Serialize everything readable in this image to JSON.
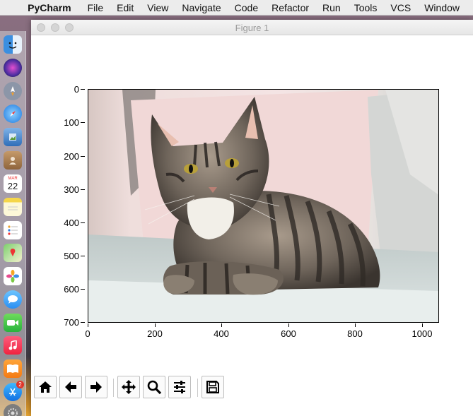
{
  "menubar": {
    "app": "PyCharm",
    "items": [
      "File",
      "Edit",
      "View",
      "Navigate",
      "Code",
      "Refactor",
      "Run",
      "Tools",
      "VCS",
      "Window"
    ]
  },
  "window": {
    "title": "Figure 1"
  },
  "figure": {
    "image_subject": "tabby cat lying on a grey sofa",
    "y_ticks": [
      "0",
      "100",
      "200",
      "300",
      "400",
      "500",
      "600",
      "700"
    ],
    "x_ticks": [
      "0",
      "200",
      "400",
      "600",
      "800",
      "1000"
    ],
    "x_range": [
      0,
      1050
    ],
    "y_range": [
      0,
      700
    ]
  },
  "toolbar": {
    "buttons": [
      "home",
      "back",
      "forward",
      "pan",
      "zoom",
      "configure-subplots",
      "save"
    ]
  },
  "dock": {
    "calendar_day": "22",
    "calendar_month": "MAR",
    "appstore_badge": "2"
  }
}
